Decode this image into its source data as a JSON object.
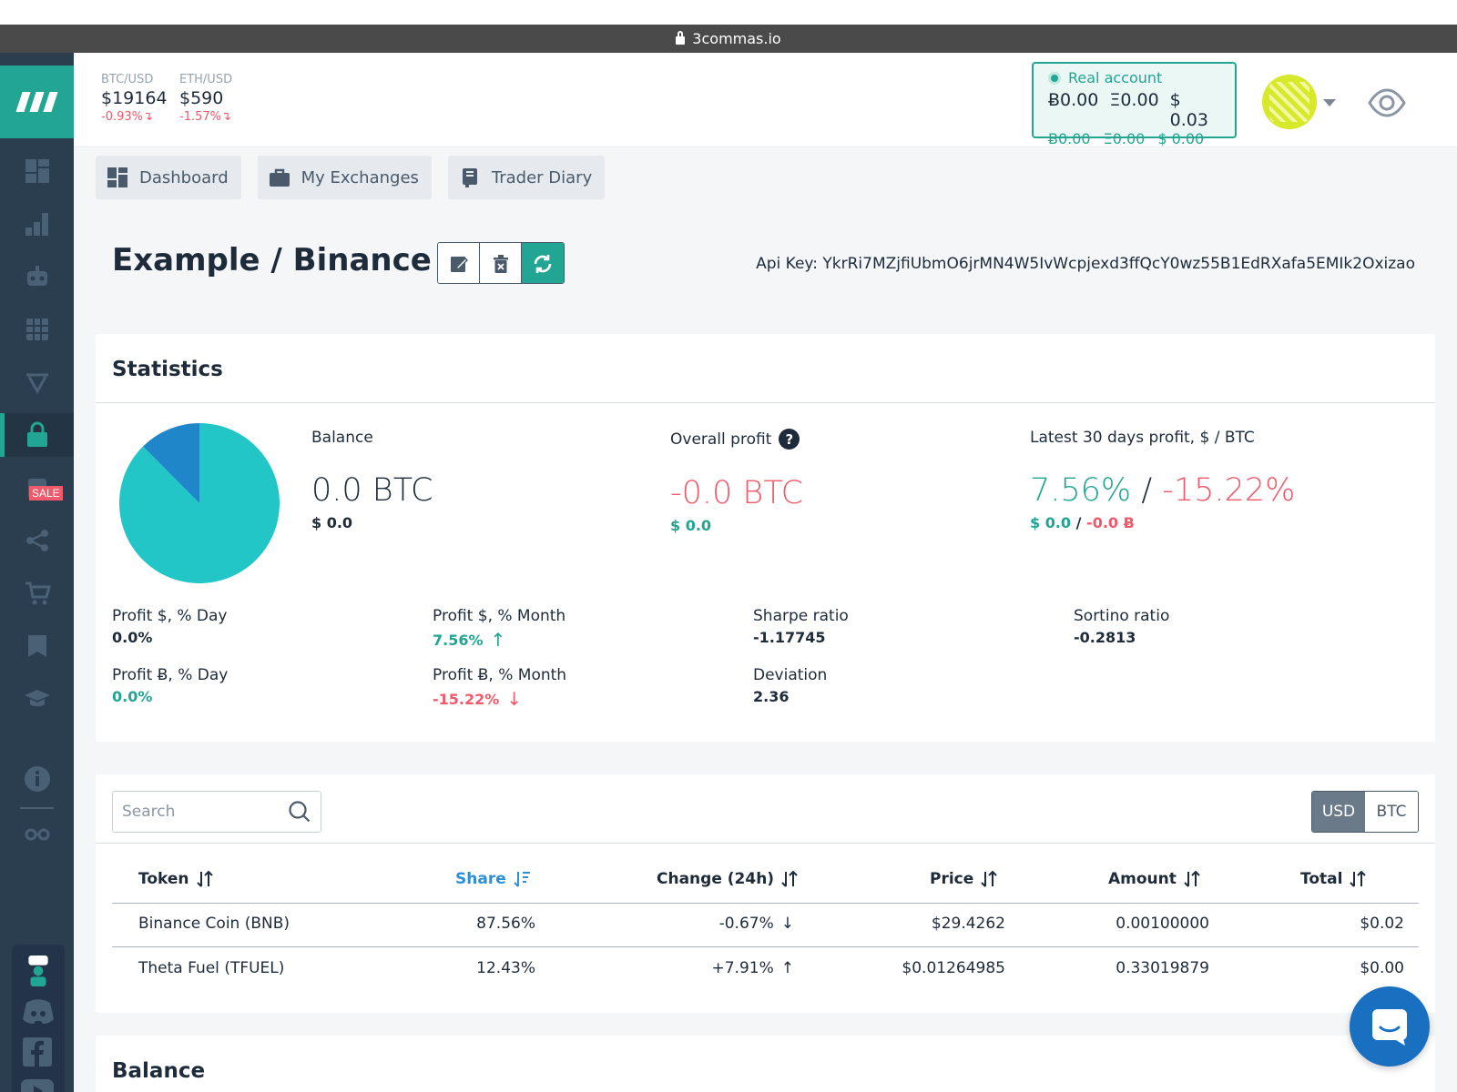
{
  "browser": {
    "url": "3commas.io"
  },
  "tickers": [
    {
      "pair": "BTC/USD",
      "price": "$19164",
      "change": "-0.93%"
    },
    {
      "pair": "ETH/USD",
      "price": "$590",
      "change": "-1.57%"
    }
  ],
  "account": {
    "title": "Real account",
    "row1": [
      "Ƀ0.00",
      "Ξ0.00",
      "$ 0.03"
    ],
    "row2": [
      "Ƀ0.00",
      "Ξ0.00",
      "$ 0.00"
    ]
  },
  "tabs": [
    {
      "label": "Dashboard",
      "icon": "dashboard-icon"
    },
    {
      "label": "My Exchanges",
      "icon": "briefcase-icon"
    },
    {
      "label": "Trader Diary",
      "icon": "book-icon"
    }
  ],
  "page": {
    "title": "Example / Binance",
    "api_key": "Api Key: YkrRi7MZjfiUbmO6jrMN4W5IvWcpjexd3ffQcY0wz55B1EdRXafa5EMIk2Oxizao"
  },
  "statistics": {
    "title": "Statistics",
    "balance": {
      "label": "Balance",
      "value": "0.0 BTC",
      "sub": "$ 0.0"
    },
    "overall_profit": {
      "label": "Overall profit",
      "value": "-0.0 BTC",
      "sub": "$ 0.0"
    },
    "latest30": {
      "label": "Latest 30 days profit, $ / BTC",
      "value_pos": "7.56%",
      "slash": "/",
      "value_neg": "-15.22%",
      "sub_pos": "$ 0.0",
      "sub_slash": "/",
      "sub_neg": "-0.0 Ƀ"
    },
    "metrics": {
      "profit_usd_day": {
        "label": "Profit $, % Day",
        "value": "0.0%"
      },
      "profit_usd_month": {
        "label": "Profit $, % Month",
        "value": "7.56%"
      },
      "sharpe": {
        "label": "Sharpe ratio",
        "value": "-1.17745"
      },
      "sortino": {
        "label": "Sortino ratio",
        "value": "-0.2813"
      },
      "profit_btc_day": {
        "label": "Profit Ƀ, % Day",
        "value": "0.0%"
      },
      "profit_btc_month": {
        "label": "Profit Ƀ, % Month",
        "value": "-15.22%"
      },
      "deviation": {
        "label": "Deviation",
        "value": "2.36"
      }
    },
    "pie": {
      "slices": [
        {
          "label": "Binance Coin (BNB)",
          "share": 87.56,
          "color": "#22c6c6"
        },
        {
          "label": "Theta Fuel (TFUEL)",
          "share": 12.43,
          "color": "#1f86c9"
        }
      ]
    }
  },
  "holdings": {
    "search_placeholder": "Search",
    "currency": [
      "USD",
      "BTC"
    ],
    "columns": [
      "Token",
      "Share",
      "Change (24h)",
      "Price",
      "Amount",
      "Total"
    ],
    "rows": [
      {
        "token": "Binance Coin (BNB)",
        "share": "87.56%",
        "change": "-0.67%",
        "dir": "down",
        "price": "$29.4262",
        "amount": "0.00100000",
        "total": "$0.02"
      },
      {
        "token": "Theta Fuel (TFUEL)",
        "share": "12.43%",
        "change": "+7.91%",
        "dir": "up",
        "price": "$0.01264985",
        "amount": "0.33019879",
        "total": "$0.00"
      }
    ]
  },
  "balance_section": {
    "title": "Balance"
  },
  "colors": {
    "accent": "#22a592",
    "negative": "#f05a6a",
    "sidebar": "#2b3e4f",
    "sorted": "#2e8fd6"
  }
}
